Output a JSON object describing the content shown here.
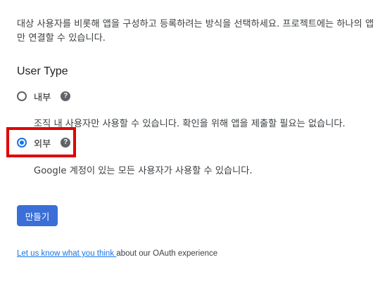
{
  "intro_text": "대상 사용자를 비롯해 앱을 구성하고 등록하려는 방식을 선택하세요. 프로젝트에는 하나의 앱만 연결할 수 있습니다.",
  "user_type": {
    "title": "User Type",
    "options": [
      {
        "label": "내부",
        "description": "조직 내 사용자만 사용할 수 있습니다. 확인을 위해 앱을 제출할 필요는 없습니다.",
        "selected": false,
        "help_icon": "help-circle-icon",
        "help_glyph": "?"
      },
      {
        "label": "외부",
        "description": "Google 계정이 있는 모든 사용자가 사용할 수 있습니다.",
        "selected": true,
        "help_icon": "help-circle-icon",
        "help_glyph": "?"
      }
    ]
  },
  "create_button": {
    "label": "만들기"
  },
  "feedback": {
    "link_text": "Let us know what you think ",
    "trailing_text": "about our OAuth experience"
  },
  "colors": {
    "accent": "#1a73e8",
    "button": "#3a6fd8",
    "highlight": "#e00000"
  }
}
